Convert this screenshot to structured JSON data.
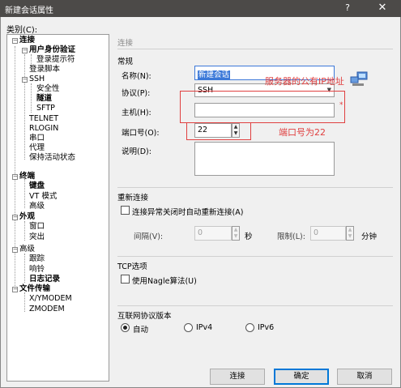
{
  "window": {
    "title": "新建会话属性",
    "help": "?",
    "close": "✕"
  },
  "category_label": "类别(C):",
  "tree": [
    {
      "label": "连接",
      "bold": true,
      "toggle": "−"
    },
    {
      "label": "用户身份验证",
      "bold": true,
      "toggle": "−"
    },
    {
      "label": "登录提示符",
      "bold": false
    },
    {
      "label": "登录脚本",
      "bold": false
    },
    {
      "label": "SSH",
      "bold": false,
      "toggle": "−"
    },
    {
      "label": "安全性",
      "bold": false
    },
    {
      "label": "隧道",
      "bold": true
    },
    {
      "label": "SFTP",
      "bold": false
    },
    {
      "label": "TELNET",
      "bold": false
    },
    {
      "label": "RLOGIN",
      "bold": false
    },
    {
      "label": "串口",
      "bold": false
    },
    {
      "label": "代理",
      "bold": false
    },
    {
      "label": "保持活动状态",
      "bold": false
    },
    {
      "label": "终端",
      "bold": true,
      "toggle": "−"
    },
    {
      "label": "键盘",
      "bold": true
    },
    {
      "label": "VT 模式",
      "bold": false
    },
    {
      "label": "高级",
      "bold": false
    },
    {
      "label": "外观",
      "bold": true,
      "toggle": "−"
    },
    {
      "label": "窗口",
      "bold": false
    },
    {
      "label": "突出",
      "bold": false
    },
    {
      "label": "高级",
      "bold": false,
      "toggle": "−"
    },
    {
      "label": "跟踪",
      "bold": false
    },
    {
      "label": "响铃",
      "bold": false
    },
    {
      "label": "日志记录",
      "bold": true
    },
    {
      "label": "文件传输",
      "bold": true,
      "toggle": "−"
    },
    {
      "label": "X/YMODEM",
      "bold": false
    },
    {
      "label": "ZMODEM",
      "bold": false
    }
  ],
  "breadcrumb": "连接",
  "general": {
    "section": "常规",
    "name_label": "名称(N):",
    "name_value": "新建会话",
    "protocol_label": "协议(P):",
    "protocol_value": "SSH",
    "host_label": "主机(H):",
    "host_value": "",
    "port_label": "端口号(O):",
    "port_value": "22",
    "desc_label": "说明(D):",
    "desc_value": ""
  },
  "reconnect": {
    "section": "重新连接",
    "auto_label": "连接异常关闭时自动重新连接(A)",
    "interval_label": "间隔(V):",
    "interval_value": "0",
    "interval_unit": "秒",
    "limit_label": "限制(L):",
    "limit_value": "0",
    "limit_unit": "分钟"
  },
  "tcp": {
    "section": "TCP选项",
    "nagle_label": "使用Nagle算法(U)"
  },
  "ip": {
    "section": "互联网协议版本",
    "options": [
      "自动",
      "IPv4",
      "IPv6"
    ],
    "selected": "自动"
  },
  "annotations": {
    "host_note": "服务器的公有IP地址",
    "port_note": "端口号为22",
    "required_mark": "*"
  },
  "buttons": {
    "connect": "连接",
    "ok": "确定",
    "cancel": "取消"
  },
  "colors": {
    "titlebar": "#4c4a48",
    "annotation": "#e04040",
    "selection": "#3b78d8"
  }
}
